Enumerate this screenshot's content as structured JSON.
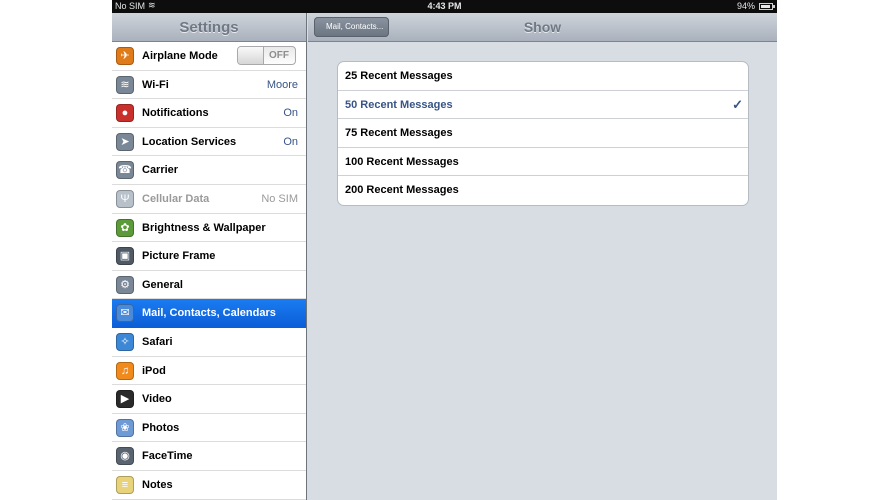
{
  "status_bar": {
    "carrier": "No SIM",
    "time": "4:43 PM",
    "battery_pct": "94%",
    "battery_level": 0.94
  },
  "master": {
    "title": "Settings",
    "items": [
      {
        "label": "Airplane Mode",
        "icon": "airplane-icon",
        "color": "#e07b1a",
        "toggle": "OFF"
      },
      {
        "label": "Wi-Fi",
        "value": "Moore",
        "icon": "wifi-icon",
        "color": "#7a8796"
      },
      {
        "label": "Notifications",
        "value": "On",
        "icon": "notifications-icon",
        "color": "#c9302c"
      },
      {
        "label": "Location Services",
        "value": "On",
        "icon": "location-icon",
        "color": "#7a8796"
      },
      {
        "label": "Carrier",
        "icon": "phone-icon",
        "color": "#7a8796"
      },
      {
        "label": "Cellular Data",
        "value": "No SIM",
        "icon": "cellular-icon",
        "color": "#b8c0ca",
        "disabled": true
      },
      {
        "label": "Brightness & Wallpaper",
        "icon": "brightness-icon",
        "color": "#5c9a3a"
      },
      {
        "label": "Picture Frame",
        "icon": "picture-frame-icon",
        "color": "#4f5a66"
      },
      {
        "label": "General",
        "icon": "gear-icon",
        "color": "#7a8796"
      },
      {
        "label": "Mail, Contacts, Calendars",
        "icon": "mail-icon",
        "color": "#4a8ad8",
        "selected": true
      },
      {
        "label": "Safari",
        "icon": "safari-icon",
        "color": "#3c88d6"
      },
      {
        "label": "iPod",
        "icon": "ipod-icon",
        "color": "#f08a1c"
      },
      {
        "label": "Video",
        "icon": "video-icon",
        "color": "#2a2a2a"
      },
      {
        "label": "Photos",
        "icon": "photos-icon",
        "color": "#6e9ad6"
      },
      {
        "label": "FaceTime",
        "icon": "facetime-icon",
        "color": "#5a6470"
      },
      {
        "label": "Notes",
        "icon": "notes-icon",
        "color": "#e8d27a"
      }
    ]
  },
  "detail": {
    "back_label": "Mail, Contacts...",
    "title": "Show",
    "options": [
      {
        "label": "25 Recent Messages",
        "checked": false
      },
      {
        "label": "50 Recent Messages",
        "checked": true
      },
      {
        "label": "75 Recent Messages",
        "checked": false
      },
      {
        "label": "100 Recent Messages",
        "checked": false
      },
      {
        "label": "200 Recent Messages",
        "checked": false
      }
    ],
    "check_glyph": "✓"
  }
}
